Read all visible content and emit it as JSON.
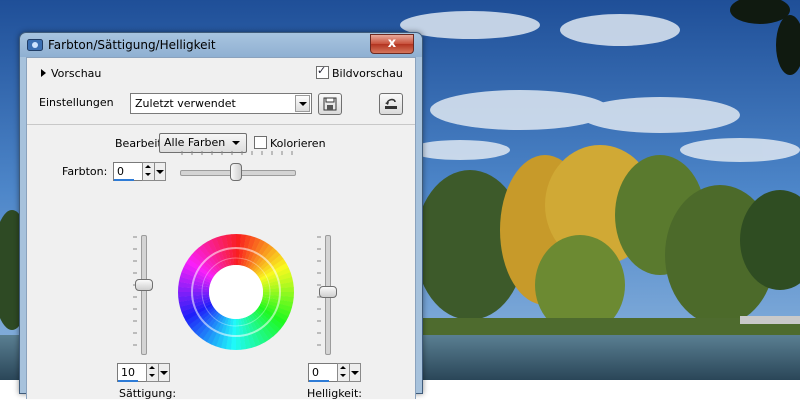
{
  "window": {
    "title": "Farbton/Sättigung/Helligkeit",
    "close_glyph": "x"
  },
  "top": {
    "preview_label": "Vorschau",
    "image_preview_label": "Bildvorschau",
    "image_preview_checked": true,
    "settings_label": "Einstellungen",
    "settings_value": "Zuletzt verwendet"
  },
  "panel": {
    "edit_label": "Bearbeiten:",
    "edit_value": "Alle Farben",
    "colorize_label": "Kolorieren",
    "colorize_checked": false,
    "hue_label": "Farbton:",
    "hue_value": "0",
    "saturation_label": "Sättigung:",
    "saturation_value": "10",
    "lightness_label": "Helligkeit:",
    "lightness_value": "0"
  },
  "icons": {
    "title": "app-icon",
    "save": "save-icon",
    "reset": "reset-icon"
  },
  "colors": {
    "title_bar": "#9bb9d8",
    "close_button": "#c8503a",
    "value_bar": "#2e7bd6"
  }
}
